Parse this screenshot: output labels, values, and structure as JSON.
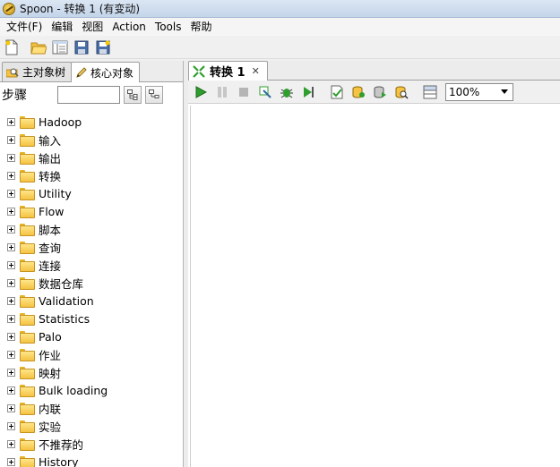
{
  "window": {
    "title": "Spoon - 转换 1 (有变动)"
  },
  "menu": [
    "文件(F)",
    "编辑",
    "视图",
    "Action",
    "Tools",
    "帮助"
  ],
  "left_tabs": [
    {
      "label": "主对象树",
      "active": false
    },
    {
      "label": "核心对象",
      "active": true
    }
  ],
  "steps": {
    "label": "步骤",
    "search_value": ""
  },
  "tree": [
    "Hadoop",
    "输入",
    "输出",
    "转换",
    "Utility",
    "Flow",
    "脚本",
    "查询",
    "连接",
    "数据仓库",
    "Validation",
    "Statistics",
    "Palo",
    "作业",
    "映射",
    "Bulk loading",
    "内联",
    "实验",
    "不推荐的",
    "History"
  ],
  "editor_tab": {
    "label": "转换 1"
  },
  "zoom": {
    "value": "100%"
  },
  "colors": {
    "accent_green": "#2e9e2e",
    "folder_yellow": "#f5c242"
  }
}
